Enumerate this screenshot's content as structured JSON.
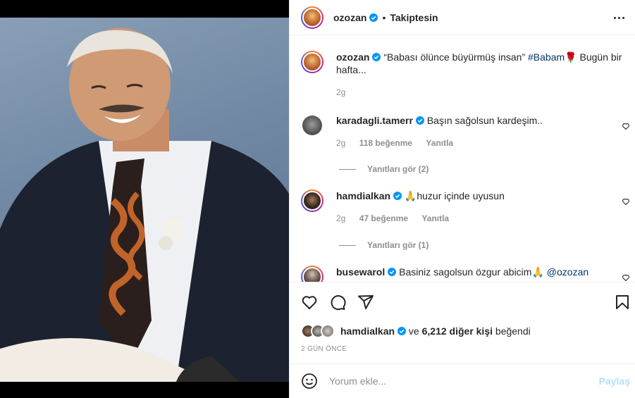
{
  "post": {
    "author": "ozozan",
    "follow_status": "Takiptesin",
    "caption_quote": "“Babası ölünce büyürmüş insan”",
    "caption_hashtag": "#Babam",
    "caption_rest": "Bugün bir hafta...",
    "caption_time": "2g"
  },
  "comments": [
    {
      "user": "karadagli.tamerr",
      "text": "Başın sağolsun kardeşim..",
      "time": "2g",
      "likes": "118 beğenme",
      "reply_label": "Yanıtla",
      "view_replies": "Yanıtları gör (2)"
    },
    {
      "user": "hamdialkan",
      "text": "🙏huzur içinde uyusun",
      "time": "2g",
      "likes": "47 beğenme",
      "reply_label": "Yanıtla",
      "view_replies": "Yanıtları gör (1)"
    },
    {
      "user": "busewarol",
      "text": "Basiniz sagolsun özgur abicim🙏",
      "mention": "@ozozan"
    }
  ],
  "likes": {
    "first_user": "hamdialkan",
    "connector": "ve",
    "others": "6,212 diğer kişi",
    "suffix": "beğendi"
  },
  "date_label": "2 GÜN ÖNCE",
  "add_comment": {
    "placeholder": "Yorum ekle...",
    "post_label": "Paylaş"
  },
  "colors": {
    "verified": "#0095f6",
    "link": "#00376b",
    "muted": "#8e8e8e",
    "post_disabled": "#b2dffc"
  },
  "icons": [
    "more-options-icon",
    "verified-icon",
    "heart-icon",
    "comment-icon",
    "share-icon",
    "bookmark-icon",
    "emoji-icon"
  ]
}
